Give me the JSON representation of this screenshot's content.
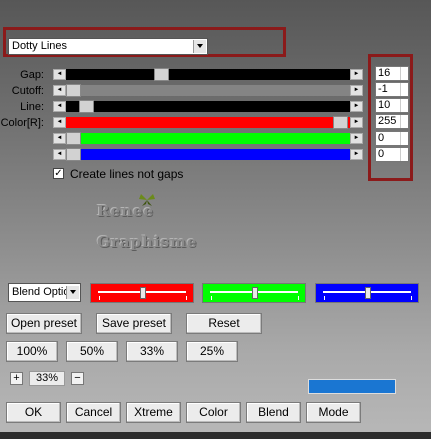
{
  "dropdown": {
    "value": "Dotty Lines"
  },
  "sliders": {
    "gap": {
      "label": "Gap:",
      "value": "16"
    },
    "cutoff": {
      "label": "Cutoff:",
      "value": "-1"
    },
    "line": {
      "label": "Line:",
      "value": "10"
    },
    "color_r": {
      "label": "Color[R]:",
      "value": "255"
    },
    "color_g": {
      "label": "",
      "value": "0"
    },
    "color_b": {
      "label": "",
      "value": "0"
    }
  },
  "checkbox": {
    "label": "Create lines not gaps",
    "checked": true,
    "mark": "✓"
  },
  "logo": {
    "line1": "Renee",
    "line2": "Graphisme"
  },
  "blend_select": {
    "value": "Blend Optio"
  },
  "buttons": {
    "open_preset": "Open preset",
    "save_preset": "Save preset",
    "reset": "Reset",
    "z100": "100%",
    "z50": "50%",
    "z33": "33%",
    "z25": "25%",
    "ok": "OK",
    "cancel": "Cancel",
    "xtreme": "Xtreme",
    "color": "Color",
    "blend": "Blend",
    "mode": "Mode"
  },
  "zoom": {
    "plus": "+",
    "value": "33%",
    "minus": "−"
  },
  "colors": {
    "red": "#ff0000",
    "green": "#00ff00",
    "blue": "#0000ff",
    "preview": "#1a76d2",
    "frame": "#8b1a1a"
  }
}
